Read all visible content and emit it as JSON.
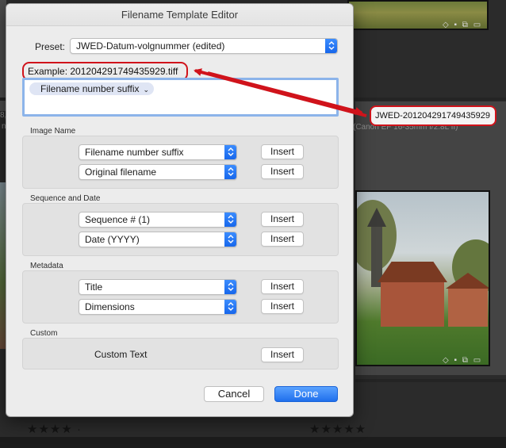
{
  "background": {
    "meta_text": "(Canon EF 16-35mm f/2.8L II)",
    "left_meta": "8,",
    "left_meta2": "n",
    "stars_left": "★★★★ ·",
    "stars_right": "★★★★★",
    "badge_icons": "◇ ▪ ⧉ ▭"
  },
  "highlight": {
    "filename": "JWED-201204291749435929"
  },
  "dialog": {
    "title": "Filename Template Editor",
    "preset_label": "Preset:",
    "preset_value": "JWED-Datum-volgnummer (edited)",
    "example_label": "Example:",
    "example_value": "201204291749435929.tiff",
    "token": "Filename number suffix",
    "sections": {
      "image_name": {
        "label": "Image Name",
        "rows": [
          {
            "value": "Filename number suffix",
            "button": "Insert"
          },
          {
            "value": "Original filename",
            "button": "Insert"
          }
        ]
      },
      "sequence_date": {
        "label": "Sequence and Date",
        "rows": [
          {
            "value": "Sequence # (1)",
            "button": "Insert"
          },
          {
            "value": "Date (YYYY)",
            "button": "Insert"
          }
        ]
      },
      "metadata": {
        "label": "Metadata",
        "rows": [
          {
            "value": "Title",
            "button": "Insert"
          },
          {
            "value": "Dimensions",
            "button": "Insert"
          }
        ]
      },
      "custom": {
        "label": "Custom",
        "text": "Custom Text",
        "button": "Insert"
      }
    },
    "cancel_label": "Cancel",
    "done_label": "Done"
  },
  "colors": {
    "highlight_red": "#d0131b",
    "accent_blue": "#1f6fec"
  },
  "icons": {
    "stepper": "up-down-chevron-icon",
    "token_chevron": "chevron-down-icon"
  }
}
